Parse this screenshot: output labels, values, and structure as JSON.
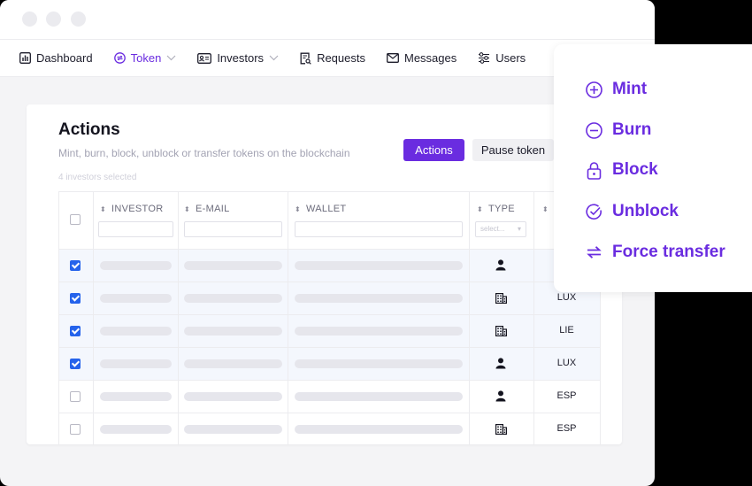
{
  "nav": {
    "dashboard": "Dashboard",
    "token": "Token",
    "investors": "Investors",
    "requests": "Requests",
    "messages": "Messages",
    "users": "Users"
  },
  "actions_card": {
    "title": "Actions",
    "subtitle": "Mint, burn, block, unblock or transfer tokens on the blockchain",
    "selected_count": "4 investors selected",
    "actions_button": "Actions",
    "pause_button": "Pause token"
  },
  "table": {
    "columns": [
      "INVESTOR",
      "E-MAIL",
      "WALLET",
      "TYPE",
      "C"
    ],
    "type_filter_placeholder": "select...",
    "rows": [
      {
        "checked": true,
        "type": "person-icon",
        "country": ""
      },
      {
        "checked": true,
        "type": "building-icon",
        "country": "LUX"
      },
      {
        "checked": true,
        "type": "building-icon",
        "country": "LIE"
      },
      {
        "checked": true,
        "type": "person-icon",
        "country": "LUX"
      },
      {
        "checked": false,
        "type": "person-icon",
        "country": "ESP"
      },
      {
        "checked": false,
        "type": "building-icon",
        "country": "ESP"
      }
    ]
  },
  "actions_menu": {
    "mint": "Mint",
    "burn": "Burn",
    "block": "Block",
    "unblock": "Unblock",
    "force_transfer": "Force transfer"
  },
  "colors": {
    "accent": "#6a2ce0",
    "checkbox": "#2563eb",
    "selected_row": "#f4f7fd"
  }
}
